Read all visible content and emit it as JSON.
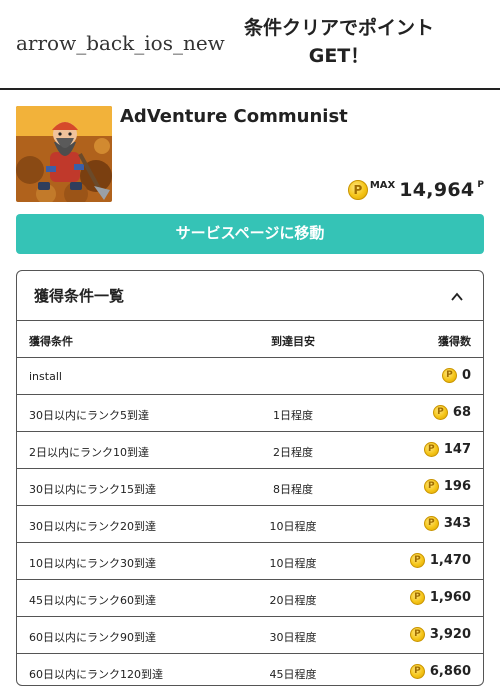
{
  "header": {
    "back_icon_text": "arrow_back_ios_new",
    "title": "条件クリアでポイントGET！"
  },
  "app": {
    "name": "AdVenture Communist",
    "max_label": "MAX",
    "max_points": "14,964",
    "points_unit": "P",
    "coin_icon": "point-coin-icon",
    "coin_symbol": "P"
  },
  "service_button": {
    "label": "サービスページに移動"
  },
  "conditions": {
    "title": "獲得条件一覧",
    "expanded": true,
    "columns": [
      "獲得条件",
      "到達目安",
      "獲得数"
    ],
    "rows": [
      {
        "condition": "install",
        "estimate": "",
        "points": "0"
      },
      {
        "condition": "30日以内にランク5到達",
        "estimate": "1日程度",
        "points": "68"
      },
      {
        "condition": "2日以内にランク10到達",
        "estimate": "2日程度",
        "points": "147"
      },
      {
        "condition": "30日以内にランク15到達",
        "estimate": "8日程度",
        "points": "196"
      },
      {
        "condition": "30日以内にランク20到達",
        "estimate": "10日程度",
        "points": "343"
      },
      {
        "condition": "10日以内にランク30到達",
        "estimate": "10日程度",
        "points": "1,470"
      },
      {
        "condition": "45日以内にランク60到達",
        "estimate": "20日程度",
        "points": "1,960"
      },
      {
        "condition": "60日以内にランク90到達",
        "estimate": "30日程度",
        "points": "3,920"
      },
      {
        "condition": "60日以内にランク120到達",
        "estimate": "45日程度",
        "points": "6,860"
      }
    ]
  },
  "colors": {
    "accent": "#35c3b6",
    "coin": "#f5c518",
    "border": "#555555"
  }
}
